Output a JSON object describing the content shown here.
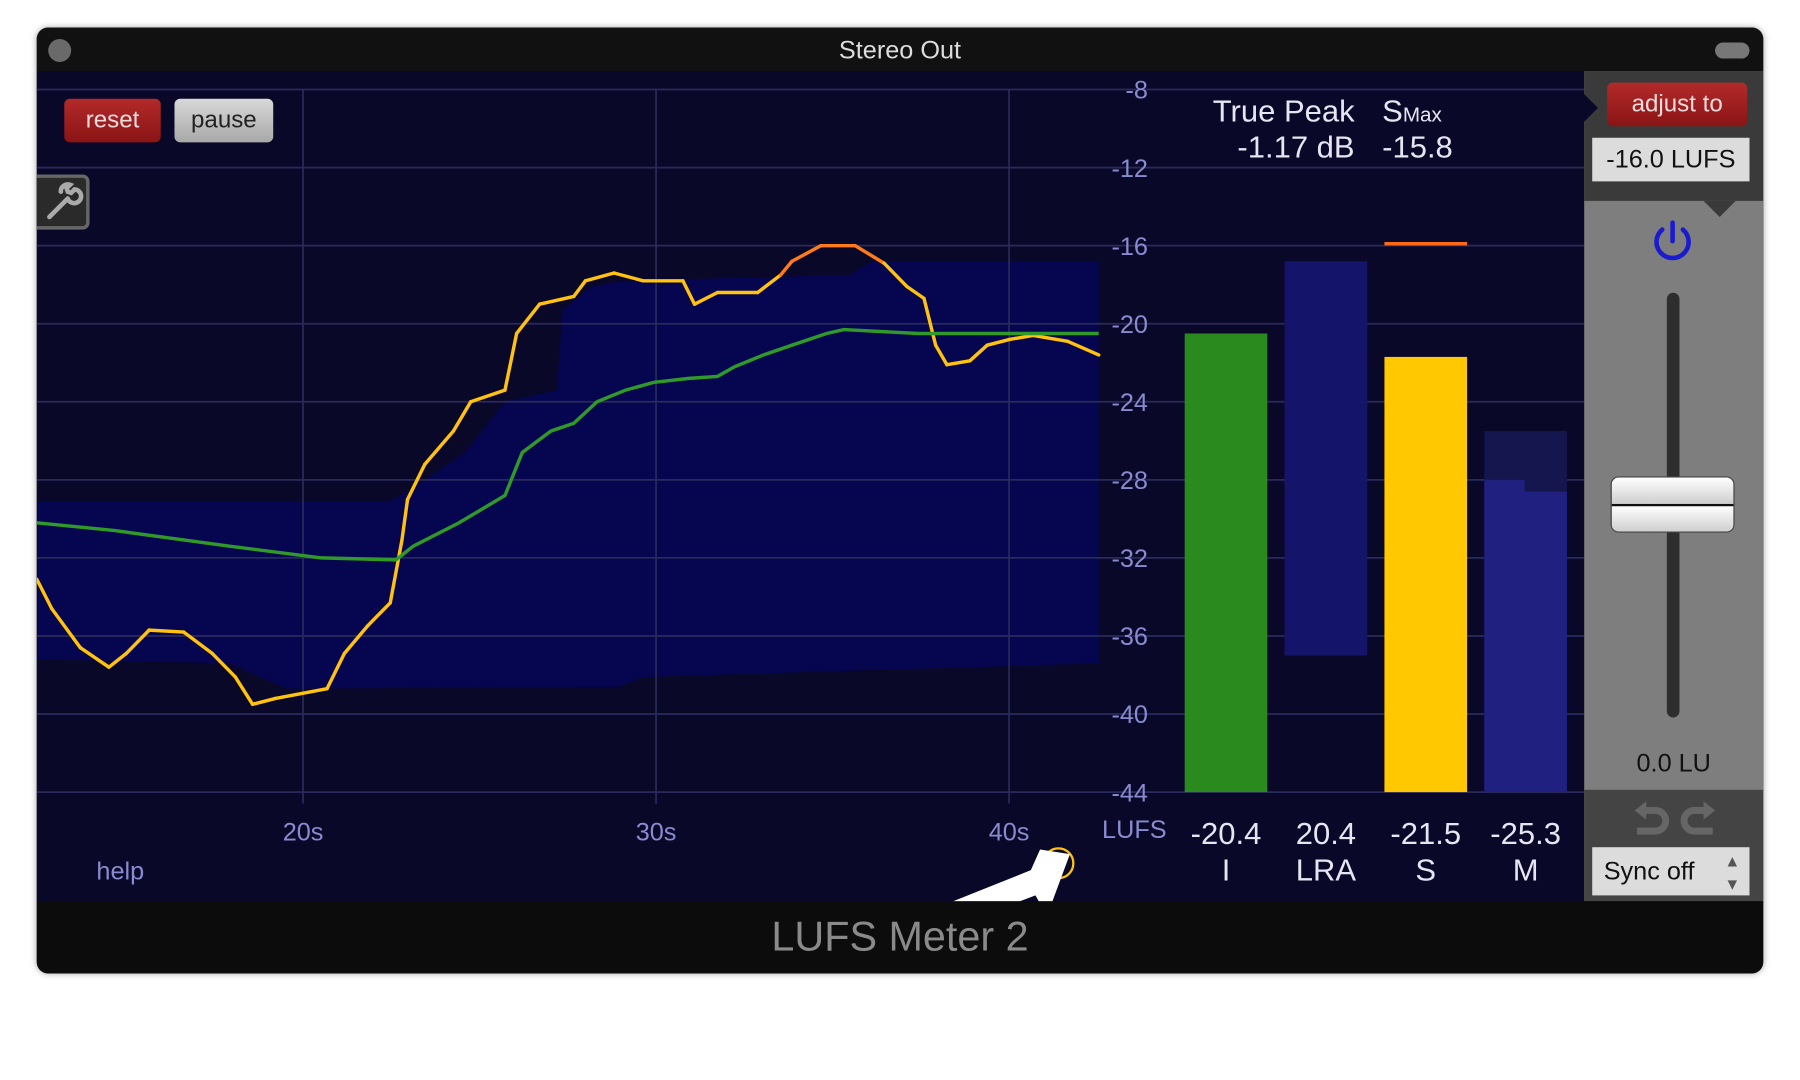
{
  "window": {
    "title": "Stereo Out",
    "footer_title": "LUFS Meter 2"
  },
  "toolbar": {
    "reset_label": "reset",
    "pause_label": "pause",
    "settings_icon": "wrench-icon",
    "help_label": "help",
    "info_icon": "info-icon"
  },
  "readouts": {
    "true_peak_label": "True Peak",
    "true_peak_value": "-1.17 dB",
    "smax_label_s": "S",
    "smax_label_max": "Max",
    "smax_value": "-15.8"
  },
  "meters": [
    {
      "value": "-20.4",
      "label": "I",
      "level": -20.5,
      "color": "#2a8a1e"
    },
    {
      "value": "20.4",
      "label": "LRA",
      "range": [
        -37.0,
        -16.8
      ],
      "color": "#14146a"
    },
    {
      "value": "-21.5",
      "label": "S",
      "level": -21.7,
      "peak": -15.9,
      "color": "#ffc800"
    },
    {
      "value": "-25.3",
      "label": "M",
      "level": -28.6,
      "peak_hold": -25.5,
      "color": "#202080"
    }
  ],
  "right_panel": {
    "adjust_label": "adjust to",
    "target_value": "-16.0 LUFS",
    "power_icon": "power-icon",
    "gain_value": "0.0 LU",
    "gain_level": 0.0,
    "undo_icon": "undo-icon",
    "redo_icon": "redo-icon",
    "sync_value": "Sync off"
  },
  "colors": {
    "accent_blue": "#1a1ad0",
    "short_term": "#ffc20e",
    "short_term_over": "#ff7a1a",
    "integrated": "#2f9a2a",
    "range_band": "#050550"
  },
  "chart_data": {
    "type": "line",
    "xlabel": "",
    "ylabel": "LUFS",
    "xlim": [
      12.46,
      42.54
    ],
    "ylim": [
      -44,
      -8
    ],
    "x_ticks": [
      {
        "v": 20,
        "label": "20s"
      },
      {
        "v": 30,
        "label": "30s"
      },
      {
        "v": 40,
        "label": "40s"
      }
    ],
    "y_ticks": [
      -8,
      -12,
      -16,
      -20,
      -24,
      -28,
      -32,
      -36,
      -40,
      -44
    ],
    "y_tick_labels": [
      "-8",
      "-12",
      "-16",
      "-20",
      "-24",
      "-28",
      "-32",
      "-36",
      "-40",
      "-44"
    ],
    "grid": true,
    "series": [
      {
        "role": "short-term",
        "color": "#ffc20e",
        "points": [
          [
            12.46,
            -33.1
          ],
          [
            12.88,
            -34.6
          ],
          [
            13.69,
            -36.6
          ],
          [
            14.5,
            -37.6
          ],
          [
            14.99,
            -36.9
          ],
          [
            15.64,
            -35.7
          ],
          [
            16.62,
            -35.8
          ],
          [
            17.43,
            -36.9
          ],
          [
            18.08,
            -38.1
          ],
          [
            18.57,
            -39.5
          ],
          [
            19.22,
            -39.2
          ],
          [
            20.68,
            -38.7
          ],
          [
            21.17,
            -36.9
          ],
          [
            21.82,
            -35.5
          ],
          [
            22.47,
            -34.3
          ],
          [
            22.8,
            -31.1
          ],
          [
            22.96,
            -29.0
          ],
          [
            23.45,
            -27.2
          ],
          [
            24.26,
            -25.5
          ],
          [
            24.75,
            -24.0
          ],
          [
            25.72,
            -23.4
          ],
          [
            26.05,
            -20.5
          ],
          [
            26.7,
            -19.0
          ],
          [
            27.67,
            -18.6
          ],
          [
            28.0,
            -17.8
          ],
          [
            28.81,
            -17.4
          ],
          [
            29.63,
            -17.8
          ],
          [
            30.76,
            -17.8
          ],
          [
            31.09,
            -19.0
          ],
          [
            31.74,
            -18.4
          ],
          [
            32.88,
            -18.4
          ],
          [
            33.53,
            -17.5
          ],
          [
            33.85,
            -16.8
          ],
          [
            34.67,
            -16.0
          ],
          [
            35.64,
            -16.0
          ],
          [
            36.46,
            -16.9
          ],
          [
            37.11,
            -18.1
          ],
          [
            37.59,
            -18.7
          ],
          [
            37.92,
            -21.1
          ],
          [
            38.24,
            -22.1
          ],
          [
            38.89,
            -21.9
          ],
          [
            39.38,
            -21.1
          ],
          [
            40.03,
            -20.8
          ],
          [
            40.68,
            -20.6
          ],
          [
            41.66,
            -20.9
          ],
          [
            42.54,
            -21.6
          ]
        ]
      },
      {
        "role": "integrated",
        "color": "#2f9a2a",
        "points": [
          [
            12.46,
            -30.2
          ],
          [
            14.67,
            -30.6
          ],
          [
            17.92,
            -31.4
          ],
          [
            20.52,
            -32.0
          ],
          [
            22.63,
            -32.1
          ],
          [
            23.12,
            -31.4
          ],
          [
            24.42,
            -30.2
          ],
          [
            25.72,
            -28.8
          ],
          [
            26.21,
            -26.6
          ],
          [
            27.02,
            -25.5
          ],
          [
            27.67,
            -25.1
          ],
          [
            28.33,
            -24.0
          ],
          [
            29.14,
            -23.4
          ],
          [
            29.95,
            -23.0
          ],
          [
            30.93,
            -22.8
          ],
          [
            31.74,
            -22.7
          ],
          [
            32.23,
            -22.2
          ],
          [
            33.04,
            -21.6
          ],
          [
            33.85,
            -21.1
          ],
          [
            34.83,
            -20.5
          ],
          [
            35.32,
            -20.3
          ],
          [
            37.43,
            -20.5
          ],
          [
            42.54,
            -20.5
          ]
        ]
      }
    ],
    "range_band": {
      "upper": [
        [
          12.46,
          -29.1
        ],
        [
          22.47,
          -29.1
        ],
        [
          23.12,
          -28.4
        ],
        [
          24.59,
          -26.6
        ],
        [
          25.72,
          -24.0
        ],
        [
          27.19,
          -23.4
        ],
        [
          27.35,
          -19.3
        ],
        [
          28.16,
          -18.1
        ],
        [
          29.14,
          -17.8
        ],
        [
          35.48,
          -17.5
        ],
        [
          36.13,
          -16.8
        ],
        [
          42.54,
          -16.8
        ]
      ],
      "lower": [
        [
          12.46,
          -37.2
        ],
        [
          17.92,
          -37.4
        ],
        [
          19.54,
          -38.7
        ],
        [
          28.98,
          -38.6
        ],
        [
          29.63,
          -38.1
        ],
        [
          42.54,
          -37.4
        ]
      ]
    }
  }
}
